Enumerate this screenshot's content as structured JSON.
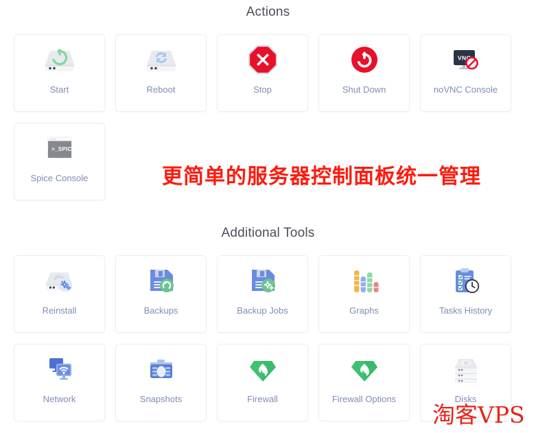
{
  "sections": {
    "actions": {
      "title": "Actions",
      "items": [
        {
          "label": "Start",
          "icon": "server-power-green-icon"
        },
        {
          "label": "Reboot",
          "icon": "server-refresh-icon"
        },
        {
          "label": "Stop",
          "icon": "stop-octagon-icon"
        },
        {
          "label": "Shut Down",
          "icon": "power-off-red-icon"
        },
        {
          "label": "noVNC Console",
          "icon": "vnc-monitor-blocked-icon"
        },
        {
          "label": "Spice Console",
          "icon": "spice-terminal-icon"
        }
      ]
    },
    "additional_tools": {
      "title": "Additional Tools",
      "items": [
        {
          "label": "Reinstall",
          "icon": "server-gear-icon"
        },
        {
          "label": "Backups",
          "icon": "floppy-restore-icon"
        },
        {
          "label": "Backup Jobs",
          "icon": "floppy-gear-icon"
        },
        {
          "label": "Graphs",
          "icon": "bar-cylinders-icon"
        },
        {
          "label": "Tasks History",
          "icon": "clipboard-clock-icon"
        },
        {
          "label": "Network",
          "icon": "monitors-wifi-icon"
        },
        {
          "label": "Snapshots",
          "icon": "camera-icon"
        },
        {
          "label": "Firewall",
          "icon": "green-diamond-flame-icon"
        },
        {
          "label": "Firewall Options",
          "icon": "green-diamond-flame-icon"
        },
        {
          "label": "Disks",
          "icon": "disk-stack-icon"
        }
      ]
    }
  },
  "overlays": {
    "promo_text": "更简单的服务器控制面板统一管理",
    "watermark_text": "淘客VPS"
  },
  "colors": {
    "label": "#7f8db5",
    "title": "#4a4f59",
    "promo": "#ff1a0d",
    "watermark": "#e8231a",
    "card_border": "#eceef1",
    "green": "#3bbd6e",
    "red": "#e8112a",
    "blue": "#6a8ce0",
    "navy": "#2b3347",
    "grey": "#d8dae0"
  }
}
